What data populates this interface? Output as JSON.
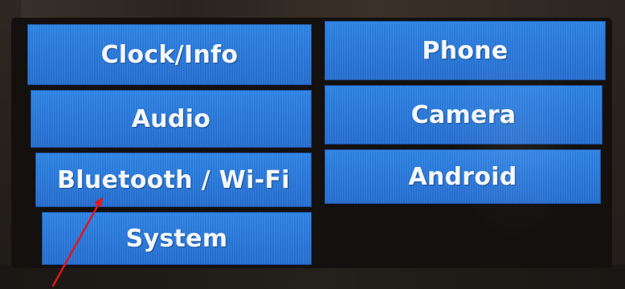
{
  "menu": {
    "left_column": [
      {
        "label": "Clock/Info"
      },
      {
        "label": "Audio"
      },
      {
        "label": "Bluetooth / Wi-Fi"
      },
      {
        "label": "System"
      }
    ],
    "right_column": [
      {
        "label": "Phone"
      },
      {
        "label": "Camera"
      },
      {
        "label": "Android"
      }
    ]
  },
  "colors": {
    "tile_blue": "#2a79dc",
    "tile_text": "#f4f7fb",
    "screen_background": "#14100d",
    "annotation_arrow": "#e01818"
  },
  "annotation": {
    "icon": "red-arrow-icon",
    "points_to": "Bluetooth / Wi-Fi"
  }
}
